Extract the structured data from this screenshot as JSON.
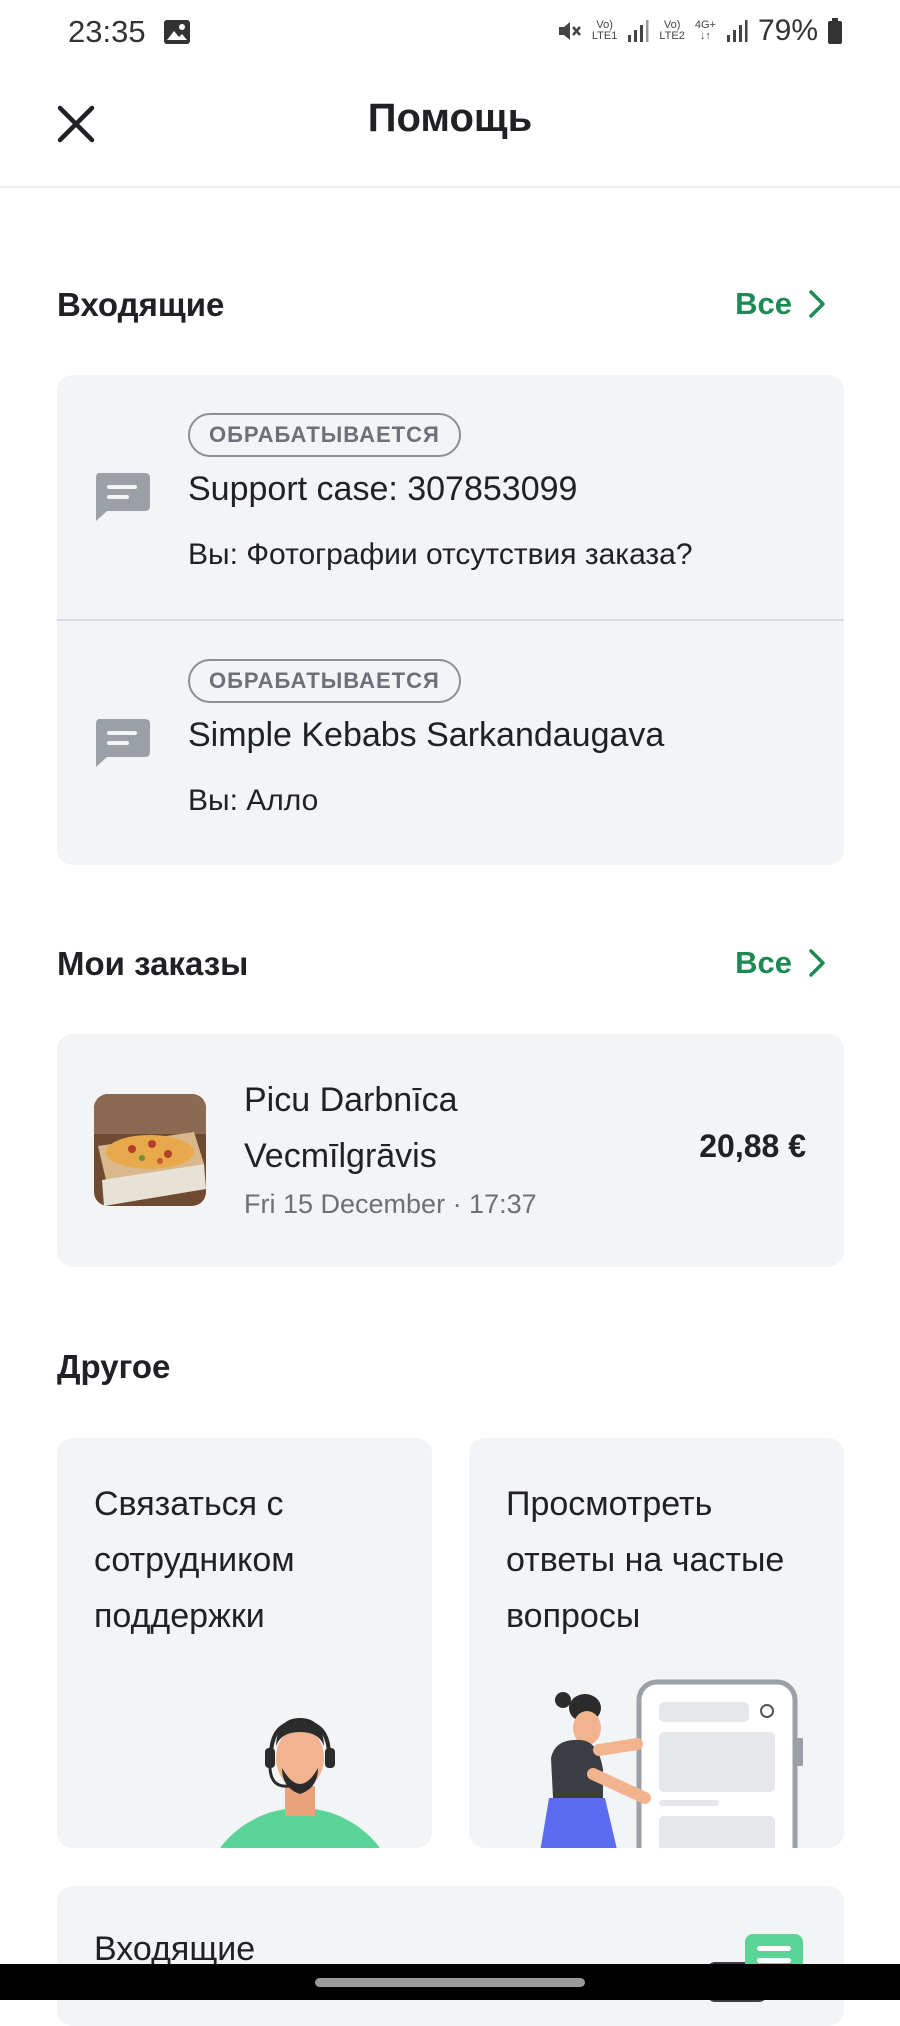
{
  "status_bar": {
    "time": "23:35",
    "sim1_top": "Vo)",
    "sim1_bottom": "LTE1",
    "sim2_top": "Vo)",
    "sim2_bottom": "LTE2",
    "network": "4G+",
    "battery": "79%"
  },
  "header": {
    "title": "Помощь",
    "close_icon": "close-icon"
  },
  "inbox": {
    "title": "Входящие",
    "see_all": "Все",
    "items": [
      {
        "status": "ОБРАБАТЫВАЕТСЯ",
        "title": "Support case: 307853099",
        "subtitle": "Вы: Фотографии отсутствия заказа?",
        "icon": "chat-icon"
      },
      {
        "status": "ОБРАБАТЫВАЕТСЯ",
        "title": "Simple Kebabs Sarkandaugava",
        "subtitle": "Вы: Алло",
        "icon": "chat-icon"
      }
    ]
  },
  "orders": {
    "title": "Мои заказы",
    "see_all": "Все",
    "items": [
      {
        "name": "Picu Darbnīca Vecmīlgrāvis",
        "date": "Fri 15 December · 17:37",
        "price": "20,88 €",
        "thumb": "pizza-photo"
      }
    ]
  },
  "other": {
    "title": "Другое",
    "tiles": [
      {
        "label": "Связаться с сотрудником поддержки",
        "illustration": "support-agent-illustration"
      },
      {
        "label": "Просмотреть ответы на частые вопросы",
        "illustration": "faq-phone-illustration"
      }
    ],
    "bottom_card": {
      "label": "Входящие",
      "icon": "chat-bubbles-icon"
    }
  },
  "colors": {
    "accent_green": "#1d8a54",
    "card_bg": "#f3f4f6",
    "text": "#202125",
    "muted": "#6b7079"
  }
}
